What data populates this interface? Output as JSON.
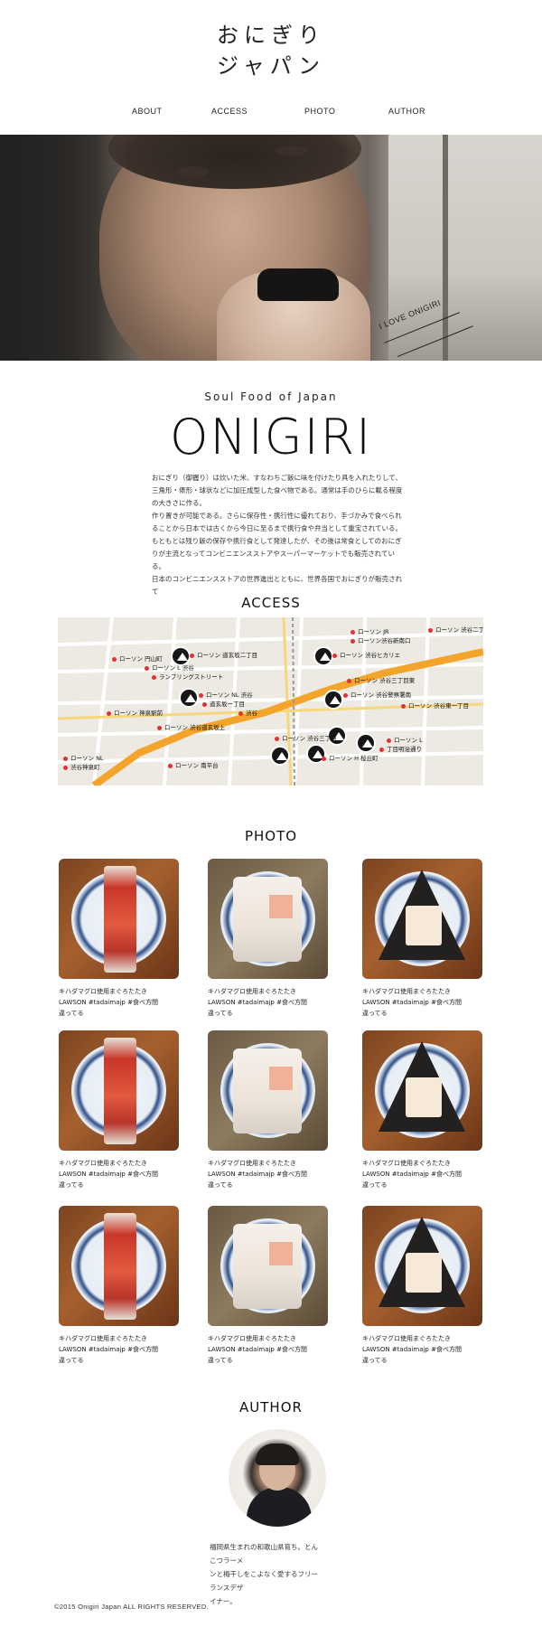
{
  "header": {
    "logo_line1": "おにぎり",
    "logo_line2": "ジャパン"
  },
  "nav": {
    "items": [
      "ABOUT",
      "ACCESS",
      "PHOTO",
      "AUTHOR"
    ]
  },
  "hero": {
    "tagline": "I LOVE ONIGIRI"
  },
  "intro": {
    "subtitle": "Soul Food of Japan",
    "title": "ONIGIRI",
    "paragraph1": "おにぎり（御握り）は炊いた米、すなわちご飯に味を付けたり具を入れたりして、三角形・俵形・球状などに加圧成型した食べ物である。通常は手のひらに載る程度の大きさに作る。",
    "paragraph2": "作り置きが可能である。さらに保存性・携行性に優れており、手づかみで食べられることから日本では古くから今日に至るまで携行食や弁当として重宝されている。",
    "paragraph3": "もともとは残り飯の保存や携行食として発達したが、その後は常食としてのおにぎりが主流となってコンビニエンスストアやスーパーマーケットでも販売されている。",
    "paragraph4": "日本のコンビニエンスストアの世界進出とともに、世界各国でおにぎりが販売されて"
  },
  "access": {
    "title": "ACCESS",
    "map_labels": [
      "ローソン 渋谷二丁目",
      "ローソン JR",
      "ローソン渋谷新南口",
      "ローソン 円山町",
      "ローソン 道玄坂二丁目",
      "ローソン 渋谷ヒカリエ",
      "ローソン L 渋谷",
      "ランブリングストリート",
      "ローソン 渋谷三丁目東",
      "ローソン NL 渋谷",
      "道玄坂一丁目",
      "ローソン 渋谷警察署南",
      "ローソン 神泉駅前",
      "ローソン 渋谷東一丁目",
      "ローソン 渋谷道玄坂上",
      "ローソン L",
      "ローソン 渋谷三丁目",
      "渋谷",
      "ローソン NL",
      "渋谷神泉町",
      "ローソン H 桜丘町",
      "丁目明治通り",
      "ローソン 南平台"
    ]
  },
  "photo": {
    "title": "PHOTO",
    "items": [
      {
        "line1": "キハダマグロ使用まぐろたたき",
        "line2": "LAWSON #tadaimajp #食べ方間",
        "line3": "違ってる"
      },
      {
        "line1": "キハダマグロ使用まぐろたたき",
        "line2": "LAWSON #tadaimajp #食べ方間",
        "line3": "違ってる"
      },
      {
        "line1": "キハダマグロ使用まぐろたたき",
        "line2": "LAWSON #tadaimajp #食べ方間",
        "line3": "違ってる"
      },
      {
        "line1": "キハダマグロ使用まぐろたたき",
        "line2": "LAWSON #tadaimajp #食べ方間",
        "line3": "違ってる"
      },
      {
        "line1": "キハダマグロ使用まぐろたたき",
        "line2": "LAWSON #tadaimajp #食べ方間",
        "line3": "違ってる"
      },
      {
        "line1": "キハダマグロ使用まぐろたたき",
        "line2": "LAWSON #tadaimajp #食べ方間",
        "line3": "違ってる"
      },
      {
        "line1": "キハダマグロ使用まぐろたたき",
        "line2": "LAWSON #tadaimajp #食べ方間",
        "line3": "違ってる"
      },
      {
        "line1": "キハダマグロ使用まぐろたたき",
        "line2": "LAWSON #tadaimajp #食べ方間",
        "line3": "違ってる"
      },
      {
        "line1": "キハダマグロ使用まぐろたたき",
        "line2": "LAWSON #tadaimajp #食べ方間",
        "line3": "違ってる"
      }
    ]
  },
  "author": {
    "title": "AUTHOR",
    "bio1": "福岡県生まれの和歌山県育ち。とんこつラーメ",
    "bio2": "ンと梅干しをこよなく愛するフリーランスデザ",
    "bio3": "イナー。"
  },
  "footer": {
    "copyright": "©2015 Onigiri Japan ALL RIGHTS RESERVED."
  },
  "colors": {
    "text": "#222222",
    "map_road": "#f4a42a",
    "pin": "#161616"
  }
}
